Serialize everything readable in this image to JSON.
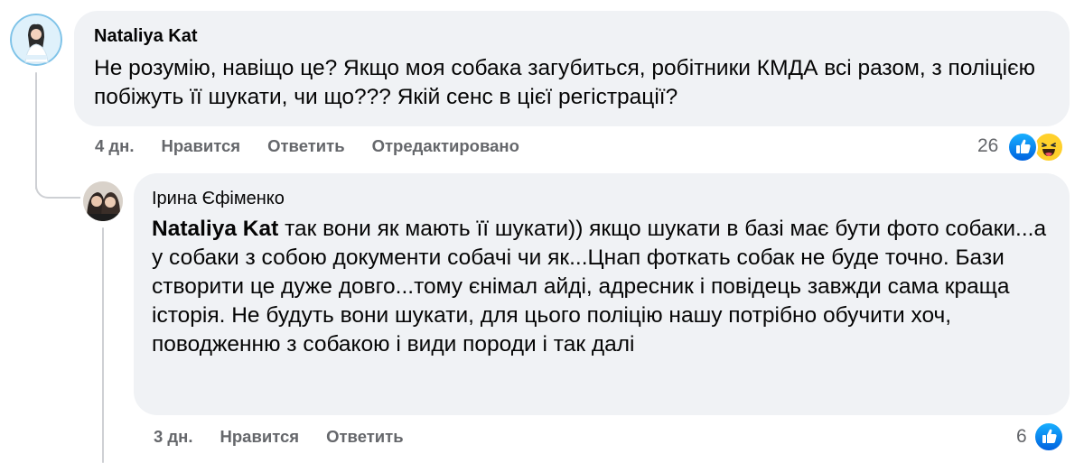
{
  "comments": [
    {
      "author": "Nataliya Kat",
      "text": "Не розумію, навіщо це? Якщо моя собака загубиться, робітники КМДА всі разом, з поліцією побіжуть її шукати, чи що??? Якій сенс в цієї регістрації?",
      "time": "4 дн.",
      "like_label": "Нравится",
      "reply_label": "Ответить",
      "edited_label": "Отредактировано",
      "reaction_count": "26",
      "reactions": [
        "like-icon",
        "haha-icon"
      ]
    },
    {
      "author": "Ірина Єфіменко",
      "mention": "Nataliya Kat",
      "text": "так вони як мають її шукати)) якщо шукати в базі має бути фото собаки...а у собаки з собою документи собачі чи як...Цнап фоткать собак не буде точно. Бази створити це дуже довго...тому єнімал айді, адресник і повідець завжди сама краща історія. Не будуть вони шукати, для цього поліцію нашу потрібно обучити хоч, поводженню з собакою і види породи і так далі",
      "time": "3 дн.",
      "like_label": "Нравится",
      "reply_label": "Ответить",
      "reaction_count": "6",
      "reactions": [
        "like-icon"
      ]
    }
  ],
  "colors": {
    "bubble": "#f0f2f5",
    "secondary_text": "#65676b",
    "primary_text": "#050505",
    "like_blue": "#0866ff",
    "haha_yellow": "#ffd02b"
  }
}
